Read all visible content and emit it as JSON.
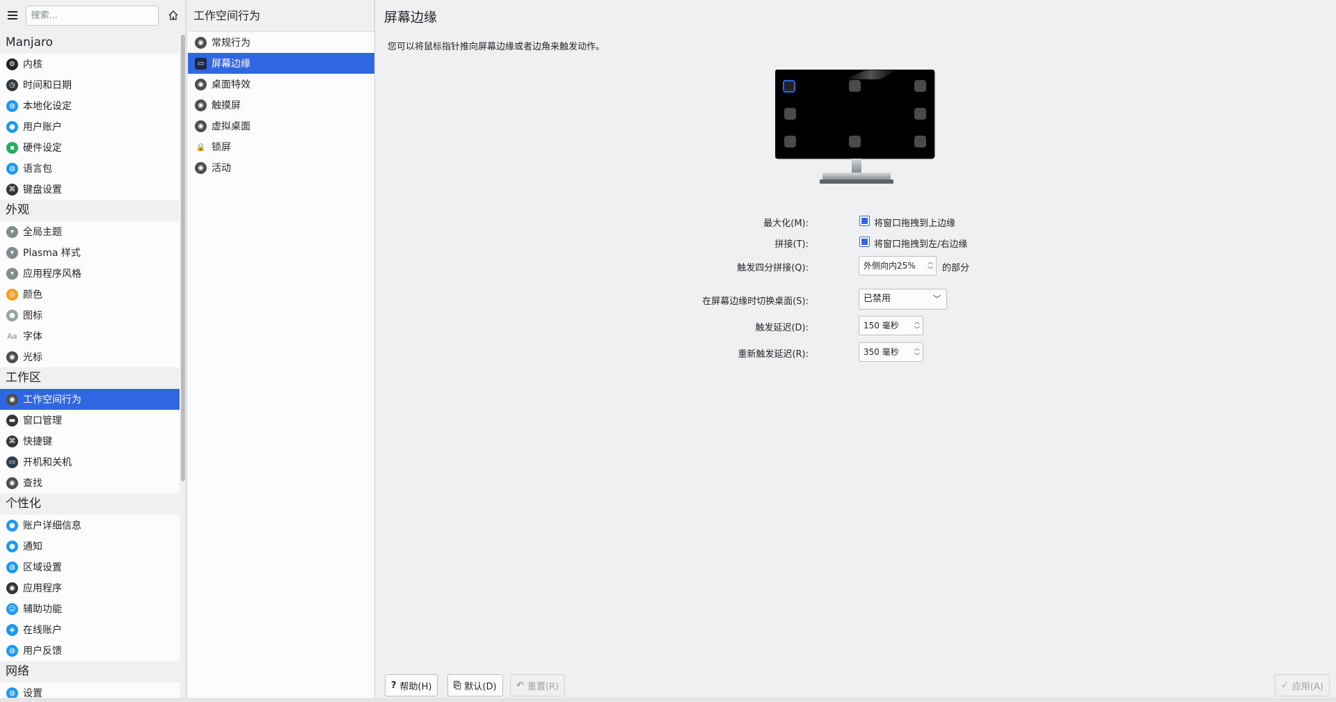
{
  "search": {
    "placeholder": "搜索..."
  },
  "sidebar": {
    "categories": [
      {
        "title": "Manjaro",
        "items": [
          {
            "label": "内核",
            "icon": "gear-cogs-icon",
            "color": "#232629"
          },
          {
            "label": "时间和日期",
            "icon": "clock-icon",
            "color": "#31363b"
          },
          {
            "label": "本地化设定",
            "icon": "globe-icon",
            "color": "#1d99f3"
          },
          {
            "label": "用户账户",
            "icon": "user-icon",
            "color": "#1d99f3"
          },
          {
            "label": "硬件设定",
            "icon": "chip-icon",
            "color": "#27ae60"
          },
          {
            "label": "语言包",
            "icon": "globe-icon",
            "color": "#1d99f3"
          },
          {
            "label": "键盘设置",
            "icon": "keyboard-icon",
            "color": "#31363b"
          }
        ]
      },
      {
        "title": "外观",
        "items": [
          {
            "label": "全局主题",
            "icon": "shirt-icon",
            "color": "#7f8c8d"
          },
          {
            "label": "Plasma 样式",
            "icon": "shirt-icon",
            "color": "#7f8c8d"
          },
          {
            "label": "应用程序风格",
            "icon": "shirt-icon",
            "color": "#7f8c8d"
          },
          {
            "label": "颜色",
            "icon": "color-wheel-icon",
            "color": "#f39c1f"
          },
          {
            "label": "图标",
            "icon": "apple-icon",
            "color": "#95a5a6"
          },
          {
            "label": "字体",
            "icon": "font-icon",
            "color": "#7f8c8d"
          },
          {
            "label": "光标",
            "icon": "cursor-icon",
            "color": "#4d4d4d"
          }
        ]
      },
      {
        "title": "工作区",
        "items": [
          {
            "label": "工作空间行为",
            "icon": "workspace-icon",
            "color": "#4d4d4d",
            "selected": true
          },
          {
            "label": "窗口管理",
            "icon": "window-icon",
            "color": "#31363b"
          },
          {
            "label": "快捷键",
            "icon": "keyboard-icon",
            "color": "#31363b"
          },
          {
            "label": "开机和关机",
            "icon": "power-icon",
            "color": "#2c3e50"
          },
          {
            "label": "查找",
            "icon": "search-gear-icon",
            "color": "#4d4d4d"
          }
        ]
      },
      {
        "title": "个性化",
        "items": [
          {
            "label": "账户详细信息",
            "icon": "user-icon",
            "color": "#1d99f3"
          },
          {
            "label": "通知",
            "icon": "notification-icon",
            "color": "#1d99f3"
          },
          {
            "label": "区域设置",
            "icon": "globe-icon",
            "color": "#1d99f3"
          },
          {
            "label": "应用程序",
            "icon": "apps-gear-icon",
            "color": "#31363b"
          },
          {
            "label": "辅助功能",
            "icon": "accessibility-icon",
            "color": "#1d99f3"
          },
          {
            "label": "在线账户",
            "icon": "compass-icon",
            "color": "#1d99f3"
          },
          {
            "label": "用户反馈",
            "icon": "globe-icon",
            "color": "#1d99f3"
          }
        ]
      },
      {
        "title": "网络",
        "items": [
          {
            "label": "设置",
            "icon": "network-icon",
            "color": "#1d99f3"
          }
        ]
      }
    ]
  },
  "middle": {
    "title": "工作空间行为",
    "items": [
      {
        "label": "常规行为",
        "icon": "gear-icon",
        "selected": false
      },
      {
        "label": "屏幕边缘",
        "icon": "screen-edge-icon",
        "selected": true
      },
      {
        "label": "桌面特效",
        "icon": "gear-icon",
        "selected": false
      },
      {
        "label": "触摸屏",
        "icon": "gear-icon",
        "selected": false
      },
      {
        "label": "虚拟桌面",
        "icon": "gear-icon",
        "selected": false
      },
      {
        "label": "锁屏",
        "icon": "lock-icon",
        "selected": false
      },
      {
        "label": "活动",
        "icon": "gear-icon",
        "selected": false
      }
    ]
  },
  "content": {
    "title": "屏幕边缘",
    "description": "您可以将鼠标指针推向屏幕边缘或者边角来触发动作。",
    "maximize": {
      "label": "最大化(M):",
      "checkbox_label": "将窗口拖拽到上边缘",
      "checked": true
    },
    "tile": {
      "label": "拼接(T):",
      "checkbox_label": "将窗口拖拽到左/右边缘",
      "checked": true
    },
    "quarter": {
      "label": "触发四分拼接(Q):",
      "value": "外侧向内25%",
      "suffix": "的部分"
    },
    "switch_desktop": {
      "label": "在屏幕边缘时切换桌面(S):",
      "value": "已禁用"
    },
    "activation_delay": {
      "label": "触发延迟(D):",
      "value": "150 毫秒"
    },
    "reactivation_delay": {
      "label": "重新触发延迟(R):",
      "value": "350 毫秒"
    }
  },
  "buttons": {
    "help": "帮助(H)",
    "defaults": "默认(D)",
    "reset": "重置(R)",
    "apply": "应用(A)"
  },
  "colors": {
    "accent": "#3166e3"
  }
}
